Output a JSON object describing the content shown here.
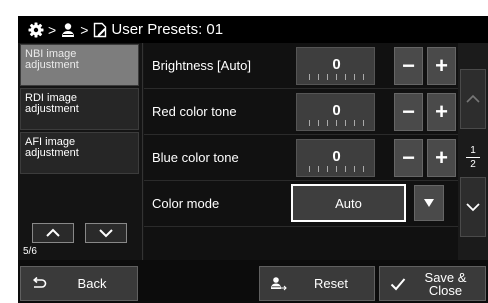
{
  "header": {
    "title": "User Presets: 01",
    "breadcrumb_icons": [
      "gear-icon",
      "user-icon",
      "document-edit-icon"
    ],
    "separator": ">"
  },
  "sidebar": {
    "items": [
      {
        "label_line1": "NBI image",
        "label_line2": "adjustment",
        "active": true
      },
      {
        "label_line1": "RDI image",
        "label_line2": "adjustment",
        "active": false
      },
      {
        "label_line1": "AFI image",
        "label_line2": "adjustment",
        "active": false
      }
    ],
    "page": "5/6"
  },
  "settings": [
    {
      "label": "Brightness [Auto]",
      "value": "0"
    },
    {
      "label": "Red color tone",
      "value": "0"
    },
    {
      "label": "Blue color tone",
      "value": "0"
    }
  ],
  "color_mode": {
    "label": "Color mode",
    "value": "Auto"
  },
  "buttons": {
    "minus": "−",
    "plus": "+"
  },
  "scroll": {
    "page_current": "1",
    "page_total": "2"
  },
  "footer": {
    "back_label": "Back",
    "reset_label": "Reset",
    "save_line1": "Save &",
    "save_line2": "Close"
  },
  "colors": {
    "background": "#151515",
    "active_item": "#7d7d7d",
    "button": "#4a4a4a",
    "highlight_border": "#ffffff"
  }
}
